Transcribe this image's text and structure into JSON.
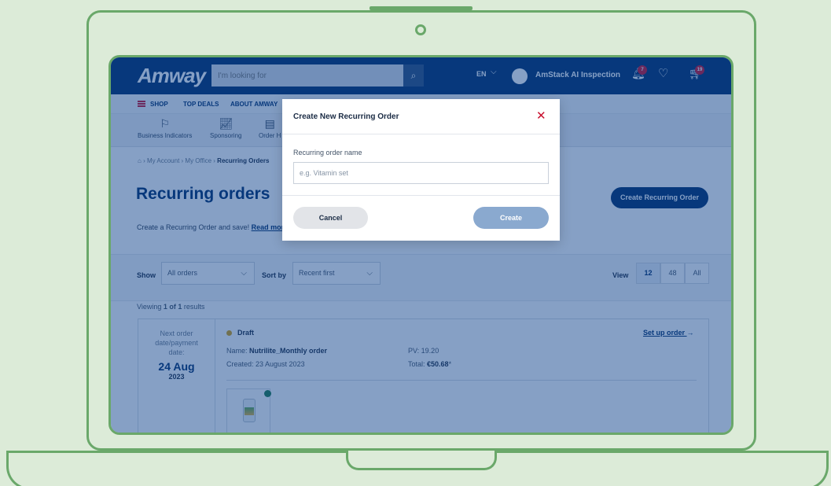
{
  "header": {
    "logo": "Amway",
    "search_placeholder": "I'm looking for",
    "language": "EN",
    "user_name": "AmStack AI Inspection",
    "notifications_count": "7",
    "cart_count": "19"
  },
  "nav": {
    "items": [
      {
        "label": "SHOP"
      },
      {
        "label": "TOP DEALS"
      },
      {
        "label": "ABOUT AMWAY"
      }
    ]
  },
  "subnav": {
    "items": [
      {
        "label": "Business Indicators",
        "icon": "flag-icon"
      },
      {
        "label": "Sponsoring",
        "icon": "growth-chart-icon"
      },
      {
        "label": "Order H",
        "icon": "clipboard-icon"
      }
    ]
  },
  "breadcrumb": {
    "home_icon": "home-icon",
    "items": [
      "My Account",
      "My Office",
      "Recurring Orders"
    ]
  },
  "page": {
    "title": "Recurring orders",
    "intro": "Create a Recurring Order and save!",
    "intro_link": "Read more",
    "create_button": "Create Recurring Order"
  },
  "filters": {
    "show_label": "Show",
    "show_value": "All orders",
    "sort_label": "Sort by",
    "sort_value": "Recent first",
    "view_label": "View",
    "view_options": [
      "12",
      "48",
      "All"
    ],
    "view_selected": "12"
  },
  "results": {
    "prefix": "Viewing",
    "range": "1 of 1",
    "suffix": "results"
  },
  "order": {
    "next_label_1": "Next order",
    "next_label_2": "date/payment",
    "next_label_3": "date:",
    "date": "24 Aug",
    "year": "2023",
    "status": "Draft",
    "status_color": "#d4a017",
    "name_label": "Name:",
    "name_value": "Nutrilite_Monthly order",
    "created": "Created: 23 August 2023",
    "pv": "PV: 19.20",
    "total_label": "Total:",
    "total_value": "€50.68",
    "total_mark": "*",
    "setup_link": "Set up order",
    "setup_arrow": "→"
  },
  "modal": {
    "title": "Create New Recurring Order",
    "field_label": "Recurring order name",
    "field_placeholder": "e.g. Vitamin set",
    "field_value": "",
    "cancel": "Cancel",
    "create": "Create"
  },
  "colors": {
    "brand": "#002f6c",
    "accent": "#c8102e",
    "overlay": "rgba(14,66,140,0.5)",
    "frame": "#6aa86a",
    "background": "#dcebd8"
  }
}
